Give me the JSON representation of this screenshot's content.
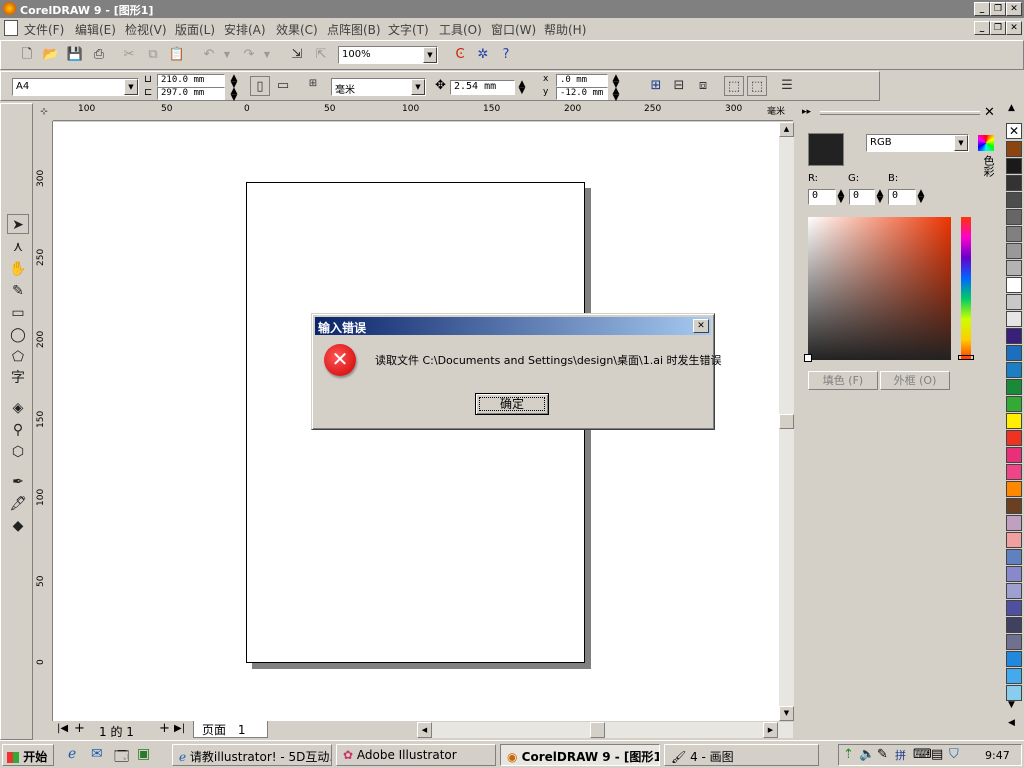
{
  "window": {
    "title": "CorelDRAW 9 - [图形1]"
  },
  "menubar": {
    "items": [
      "文件(F)",
      "编辑(E)",
      "检视(V)",
      "版面(L)",
      "安排(A)",
      "效果(C)",
      "点阵图(B)",
      "文字(T)",
      "工具(O)",
      "窗口(W)",
      "帮助(H)"
    ]
  },
  "toolbar": {
    "zoom": "100%"
  },
  "propertybar": {
    "paper": "A4",
    "width": "210.0 mm",
    "height": "297.0 mm",
    "units": "毫米",
    "nudge": "2.54 mm",
    "dup_x_label": "x",
    "dup_y_label": "y",
    "dup_x": ".0 mm",
    "dup_y": "-12.0 mm"
  },
  "ruler": {
    "h_labels": [
      "100",
      "50",
      "0",
      "50",
      "100",
      "150",
      "200",
      "250",
      "300"
    ],
    "v_labels": [
      "300",
      "250",
      "200",
      "150",
      "100",
      "50",
      "0"
    ],
    "unit": "毫米"
  },
  "pagebar": {
    "page_nav": "1 的 1",
    "page_tab": "页面",
    "page_tab_num": "1"
  },
  "docker": {
    "color_model": "RGB",
    "r_label": "R:",
    "g_label": "G:",
    "b_label": "B:",
    "r": "0",
    "g": "0",
    "b": "0",
    "fill_button": "填色 (F)",
    "outline_button": "外框 (O)"
  },
  "palette": {
    "colors": [
      "#8b4513",
      "#1a1a1a",
      "#333333",
      "#4d4d4d",
      "#666666",
      "#808080",
      "#999999",
      "#b3b3b3",
      "#ffffff",
      "#c8c8c8",
      "#e6e6e6",
      "#3a1f7a",
      "#1e6ebf",
      "#1a7fc4",
      "#1a8a3a",
      "#33aa33",
      "#ffee00",
      "#ee3322",
      "#e8307a",
      "#ee4488",
      "#ff8800",
      "#6b4020",
      "#c0a0c0",
      "#f0a0a0",
      "#6080c0",
      "#8888cc",
      "#a0a0d0",
      "#5050a0",
      "#404060",
      "#707090",
      "#2288dd",
      "#44aaee",
      "#88ccee"
    ]
  },
  "dialog": {
    "title": "输入错误",
    "message": "读取文件 C:\\Documents and Settings\\design\\桌面\\1.ai 时发生错误",
    "ok": "确定"
  },
  "taskbar": {
    "start": "开始",
    "tasks": [
      "请教illustrator! - 5D互动...",
      "Adobe Illustrator",
      "CorelDRAW 9 - [图形1]",
      "4 - 画图"
    ],
    "clock": "9:47"
  }
}
